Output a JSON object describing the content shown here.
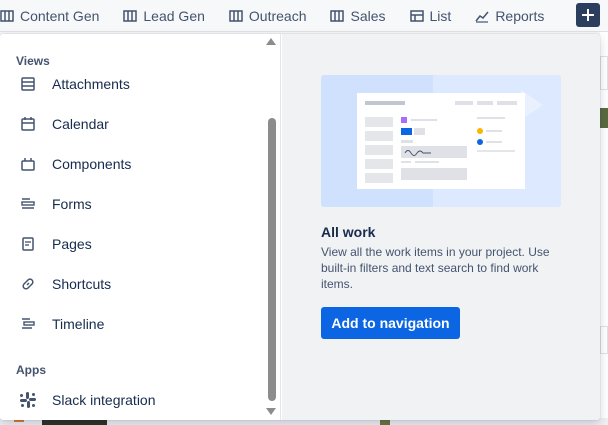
{
  "nav": {
    "tabs": [
      {
        "label": "Content Gen",
        "icon": "board-icon"
      },
      {
        "label": "Lead Gen",
        "icon": "board-icon"
      },
      {
        "label": "Outreach",
        "icon": "board-icon"
      },
      {
        "label": "Sales",
        "icon": "board-icon"
      },
      {
        "label": "List",
        "icon": "list-icon"
      },
      {
        "label": "Reports",
        "icon": "reports-icon"
      }
    ],
    "add_icon": "plus-icon"
  },
  "menu": {
    "views_label": "Views",
    "views": [
      {
        "label": "Attachments",
        "icon": "attachments-icon"
      },
      {
        "label": "Calendar",
        "icon": "calendar-icon"
      },
      {
        "label": "Components",
        "icon": "components-icon"
      },
      {
        "label": "Forms",
        "icon": "forms-icon"
      },
      {
        "label": "Pages",
        "icon": "pages-icon"
      },
      {
        "label": "Shortcuts",
        "icon": "link-icon"
      },
      {
        "label": "Timeline",
        "icon": "timeline-icon"
      }
    ],
    "apps_label": "Apps",
    "apps": [
      {
        "label": "Slack integration",
        "icon": "slack-icon"
      }
    ]
  },
  "detail": {
    "title": "All work",
    "description": "View all the work items in your project. Use built-in filters and text search to find work items.",
    "button_label": "Add to navigation"
  },
  "colors": {
    "primary": "#0c66e4",
    "illustration_bg": "#cfe1fd"
  }
}
